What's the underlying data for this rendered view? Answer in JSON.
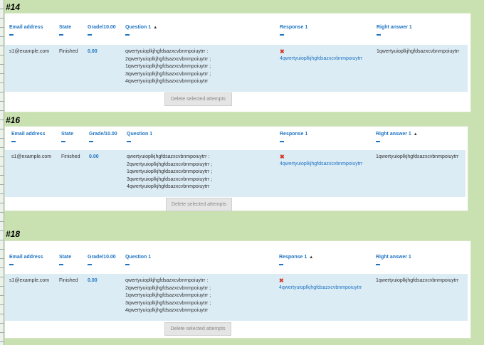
{
  "columns": {
    "email": "Email address",
    "state": "State",
    "grade": "Grade/10.00",
    "question": "Question 1",
    "response": "Response 1",
    "right": "Right answer 1"
  },
  "sections": [
    {
      "title": "#14",
      "sorted_column": "question",
      "row": {
        "email": "s1@example.com",
        "state": "Finished",
        "grade": "0.00",
        "question_lines": [
          "qwertyuioplkjhgfdsazxcvbnmpoiuytrr :",
          "2qwertyuioplkjhgfdsazxcvbnmpoiuytrr ;",
          "1qwertyuioplkjhgfdsazxcvbnmpoiuytrr ;",
          "3qwertyuioplkjhgfdsazxcvbnmpoiuytrr ;",
          "4qwertyuioplkjhgfdsazxcvbnmpoiuytrr"
        ],
        "response": "4qwertyuioplkjhgfdsazxcvbnmpoiuytrr",
        "right_answer": "1qwertyuioplkjhgfdsazxcvbnmpoiuytrr"
      },
      "button": "Delete selected attempts"
    },
    {
      "title": "#16",
      "sorted_column": "right",
      "row": {
        "email": "s1@example.com",
        "state": "Finished",
        "grade": "0.00",
        "question_lines": [
          "qwertyuioplkjhgfdsazxcvbnmpoiuytrr :",
          "2qwertyuioplkjhgfdsazxcvbnmpoiuytrr ;",
          "1qwertyuioplkjhgfdsazxcvbnmpoiuytrr ;",
          "3qwertyuioplkjhgfdsazxcvbnmpoiuytrr ;",
          "4qwertyuioplkjhgfdsazxcvbnmpoiuytrr"
        ],
        "response": "4qwertyuioplkjhgfdsazxcvbnmpoiuytrr",
        "right_answer": "1qwertyuioplkjhgfdsazxcvbnmpoiuytrr"
      },
      "button": "Delete selected attempts"
    },
    {
      "title": "#18",
      "sorted_column": "response",
      "row": {
        "email": "s1@example.com",
        "state": "Finished",
        "grade": "0.00",
        "question_lines": [
          "qwertyuioplkjhgfdsazxcvbnmpoiuytrr :",
          "2qwertyuioplkjhgfdsazxcvbnmpoiuytrr ;",
          "1qwertyuioplkjhgfdsazxcvbnmpoiuytrr ;",
          "3qwertyuioplkjhgfdsazxcvbnmpoiuytrr ;",
          "4qwertyuioplkjhgfdsazxcvbnmpoiuytrr"
        ],
        "response": "4qwertyuioplkjhgfdsazxcvbnmpoiuytrr",
        "right_answer": "1qwertyuioplkjhgfdsazxcvbnmpoiuytrr"
      },
      "button": "Delete selected attempts"
    }
  ]
}
